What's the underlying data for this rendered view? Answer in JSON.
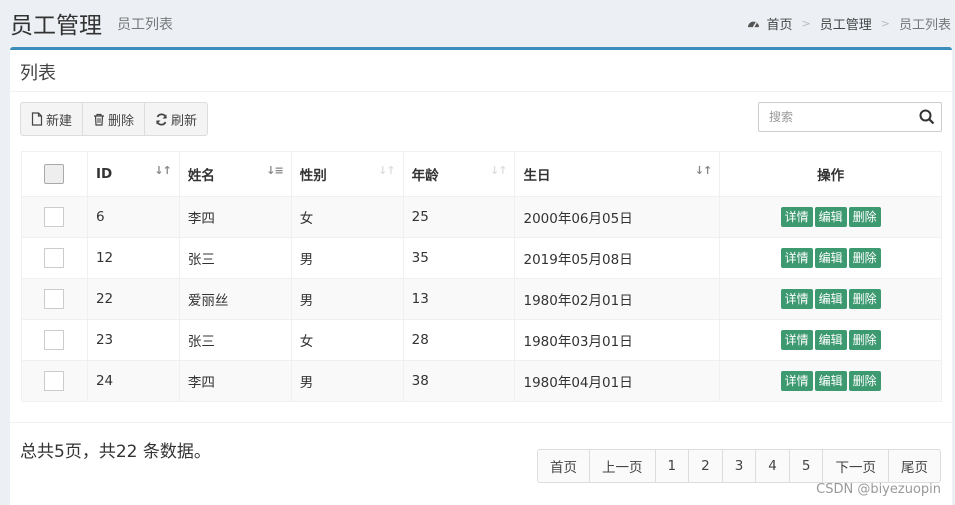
{
  "header": {
    "title": "员工管理",
    "subtitle": "员工列表",
    "breadcrumb": [
      "首页",
      "员工管理",
      "员工列表"
    ]
  },
  "box": {
    "title": "列表"
  },
  "toolbar": {
    "new_label": "新建",
    "delete_label": "删除",
    "refresh_label": "刷新"
  },
  "search": {
    "placeholder": "搜索"
  },
  "table": {
    "columns": [
      "",
      "ID",
      "姓名",
      "性别",
      "年龄",
      "生日",
      "操作"
    ],
    "rows": [
      {
        "id": "6",
        "name": "李四",
        "gender": "女",
        "age": "25",
        "birthday": "2000年06月05日"
      },
      {
        "id": "12",
        "name": "张三",
        "gender": "男",
        "age": "35",
        "birthday": "2019年05月08日"
      },
      {
        "id": "22",
        "name": "爱丽丝",
        "gender": "男",
        "age": "13",
        "birthday": "1980年02月01日"
      },
      {
        "id": "23",
        "name": "张三",
        "gender": "女",
        "age": "28",
        "birthday": "1980年03月01日"
      },
      {
        "id": "24",
        "name": "李四",
        "gender": "男",
        "age": "38",
        "birthday": "1980年04月01日"
      }
    ],
    "actions": [
      "详情",
      "编辑",
      "删除"
    ]
  },
  "summary": "总共5页，共22 条数据。",
  "pagination": [
    "首页",
    "上一页",
    "1",
    "2",
    "3",
    "4",
    "5",
    "下一页",
    "尾页"
  ],
  "watermark": "CSDN @biyezuopin",
  "colors": {
    "accent": "#3c8dbc",
    "action_button": "#3d9970"
  }
}
